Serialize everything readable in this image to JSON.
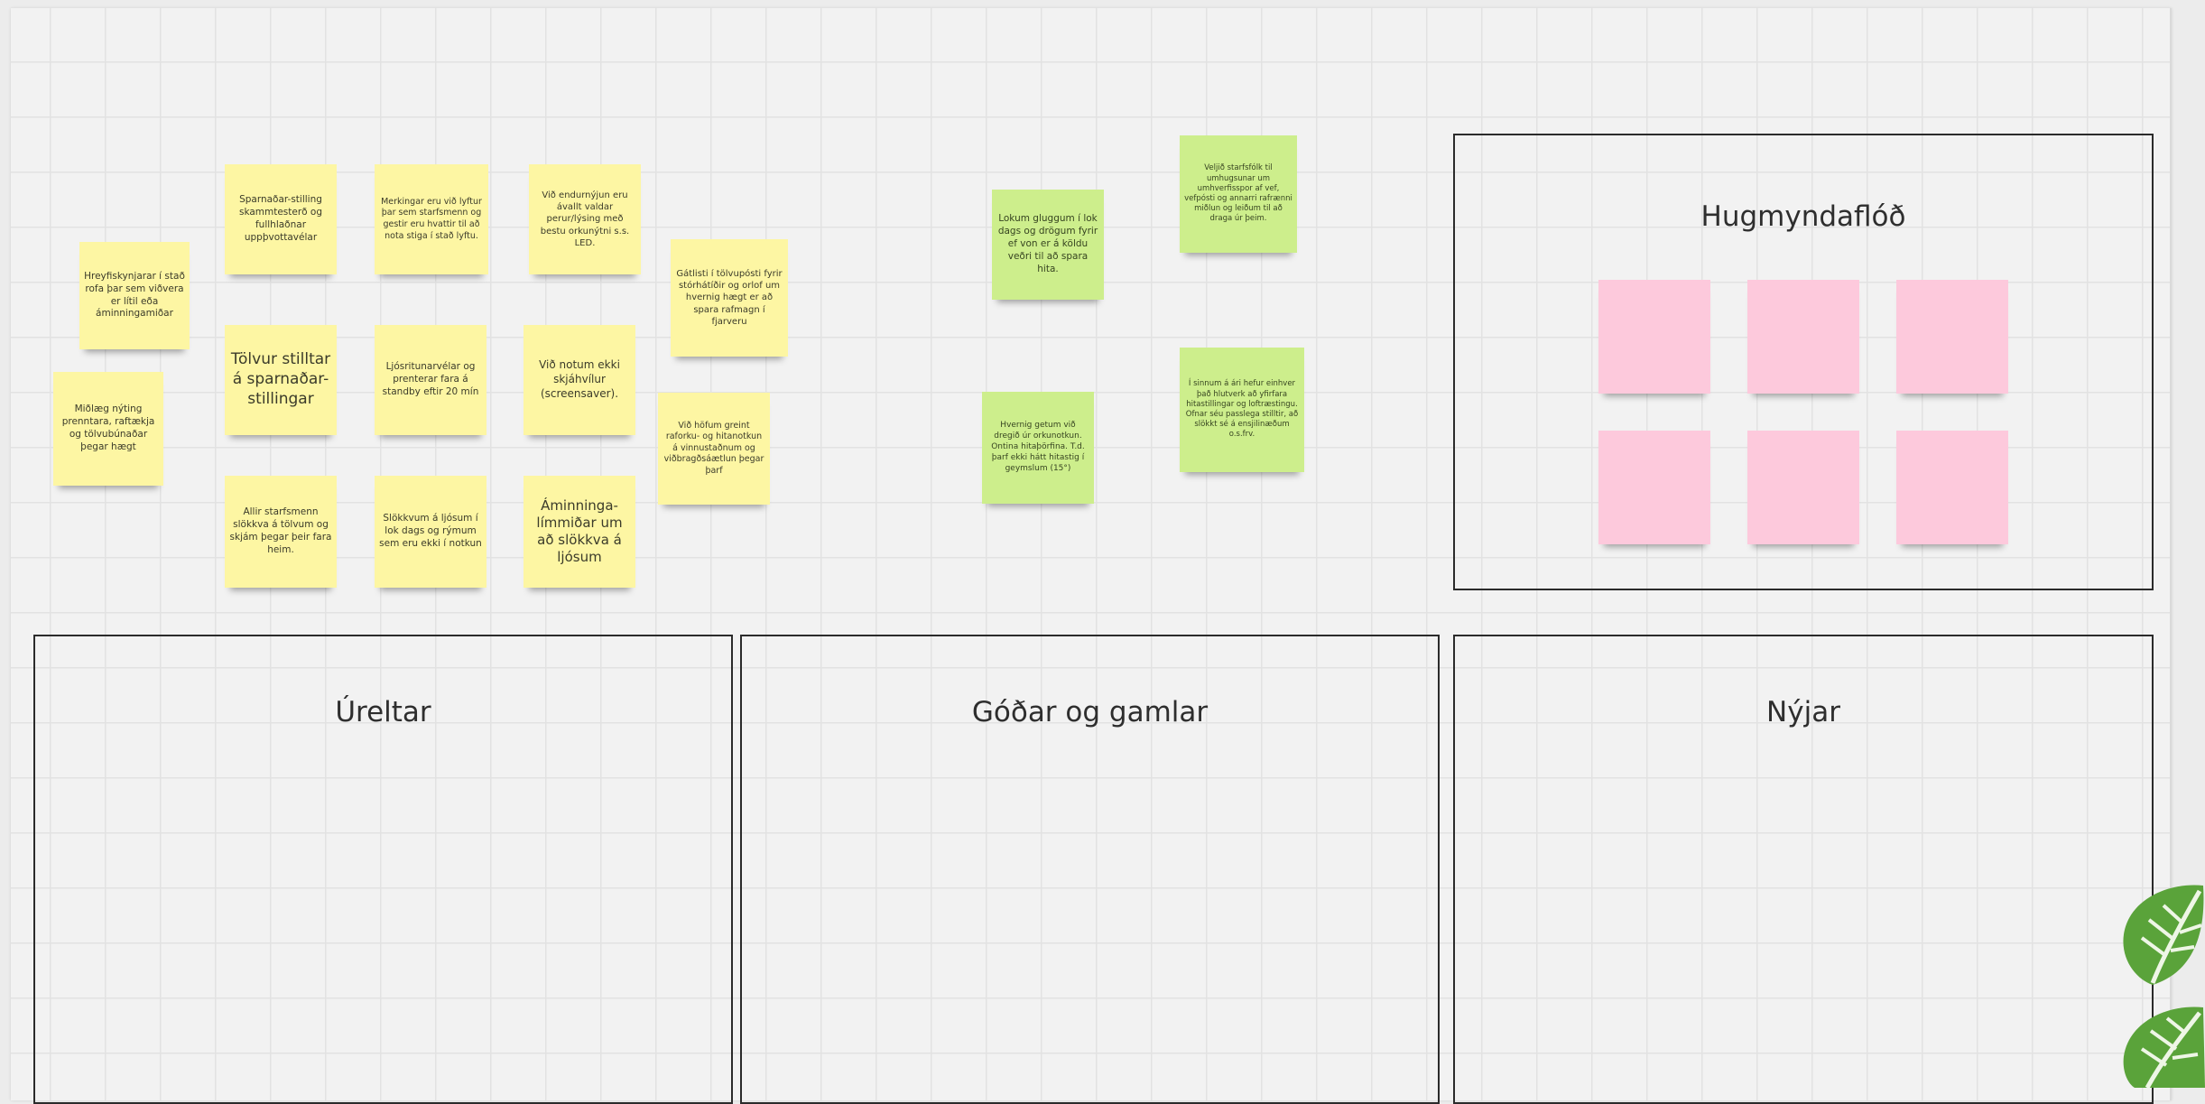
{
  "frames": {
    "brainstorm": "Hugmyndaflóð",
    "outdated": "Úreltar",
    "good_old": "Góðar og gamlar",
    "new": "Nýjar"
  },
  "yellow_notes": [
    "Hreyfiskynjarar í stað rofa þar sem viðvera er lítil eða áminningamiðar",
    "Miðlæg nýting prenntara, raftækja og tölvubúnaðar þegar hægt",
    "Sparnaðar-stilling skammtesterð og fullhlaðnar uppþvottavélar",
    "Tölvur stilltar á sparnaðar-stillingar",
    "Allir starfsmenn slökkva á tölvum og skjám þegar þeir fara heim.",
    "Merkingar eru við lyftur þar sem starfsmenn og gestir eru hvattir til að nota stiga í stað lyftu.",
    "Ljósritunarvélar og prenterar fara á standby eftir 20 mín",
    "Slökkvum á ljósum í lok dags og rýmum sem eru ekki í notkun",
    "Við endurnýjun eru ávallt valdar perur/lýsing með bestu orkunýtni s.s. LED.",
    "Við notum ekki skjáhvílur (screensaver).",
    "Áminninga-límmiðar um að slökkva á ljósum",
    "Gátlisti í tölvupósti fyrir stórhátíðir og orlof um hvernig hægt er að spara rafmagn í fjarveru",
    "Við höfum greint raforku- og hitanotkun á vinnustaðnum og viðbragðsáætlun þegar þarf"
  ],
  "green_notes": [
    "Lokum gluggum í lok dags og drögum fyrir ef von er á köldu veðri til að spara hita.",
    "Hvernig getum við dregið úr orkunotkun. Ontina hitaþörfina. T.d. þarf ekki hátt hitastig í geymslum (15°)",
    "Veljið starfsfólk til umhugsunar um umhverfisspor af vef, vefpósti og annarri rafrænni miðlun og leiðum til að draga úr þeim.",
    "Í sinnum á ári hefur einhver það hlutverk að yfirfara hitastillingar og loftræstingu. Ofnar séu passlega stilltir, að slökkt sé á ensjilinæðum o.s.frv."
  ],
  "colors": {
    "yellow": "#fdf6a3",
    "green": "#cdee8c",
    "pink": "#fdc9dc",
    "leaf": "#5aa33a"
  },
  "icons": [
    "leaf-icon",
    "leaf-icon"
  ]
}
